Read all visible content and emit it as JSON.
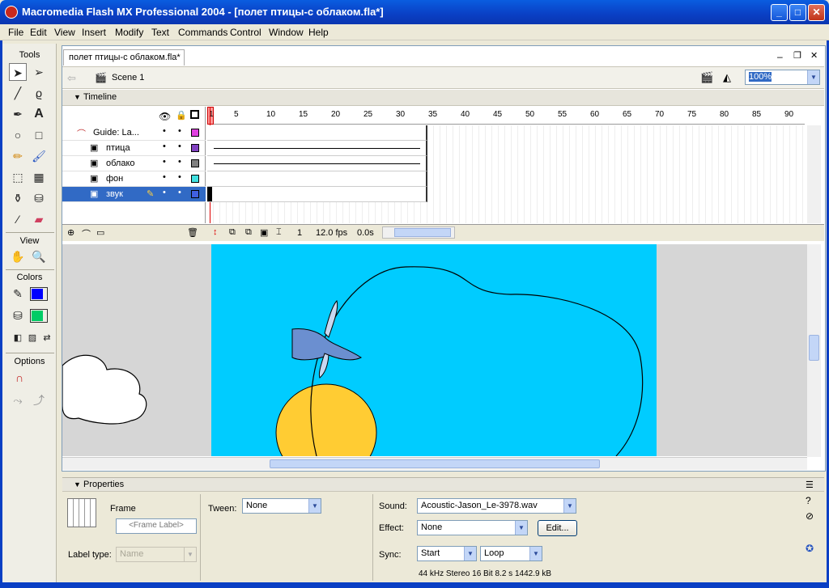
{
  "window": {
    "title": "Macromedia Flash MX Professional 2004 - [полет птицы-с облаком.fla*]",
    "minimize": "_",
    "maximize": "□",
    "close": "✕"
  },
  "menu": [
    "File",
    "Edit",
    "View",
    "Insert",
    "Modify",
    "Text",
    "Commands",
    "Control",
    "Window",
    "Help"
  ],
  "tools": {
    "section_tools": "Tools",
    "section_view": "View",
    "section_colors": "Colors",
    "section_options": "Options",
    "stroke_color": "#0000ff",
    "fill_color": "#00cc66"
  },
  "document": {
    "tab_label": "полет птицы-с облаком.fla*",
    "scene_label": "Scene 1",
    "zoom": "100%"
  },
  "timeline": {
    "title": "Timeline",
    "ruler": [
      "1",
      "5",
      "10",
      "15",
      "20",
      "25",
      "30",
      "35",
      "40",
      "45",
      "50",
      "55",
      "60",
      "65",
      "70",
      "75",
      "80",
      "85",
      "90"
    ],
    "layers": [
      {
        "name": "Guide: La...",
        "color": "#e040e0"
      },
      {
        "name": "птица",
        "color": "#8040c0"
      },
      {
        "name": "облако",
        "color": "#808080"
      },
      {
        "name": "фон",
        "color": "#40e0e0"
      },
      {
        "name": "звук",
        "color": "#4060e0"
      }
    ],
    "current_frame": "1",
    "fps": "12.0 fps",
    "time": "0.0s"
  },
  "stage": {
    "background": "#00ccff",
    "sun_color": "#ffcc33"
  },
  "properties": {
    "title": "Properties",
    "frame_label": "Frame",
    "frame_label_placeholder": "<Frame Label>",
    "label_type_label": "Label type:",
    "label_type_value": "Name",
    "tween_label": "Tween:",
    "tween_value": "None",
    "sound_label": "Sound:",
    "sound_value": "Acoustic-Jason_Le-3978.wav",
    "effect_label": "Effect:",
    "effect_value": "None",
    "edit_button": "Edit...",
    "sync_label": "Sync:",
    "sync_value": "Start",
    "loop_value": "Loop",
    "sound_info": "44 kHz Stereo 16 Bit 8.2 s 1442.9 kB"
  }
}
